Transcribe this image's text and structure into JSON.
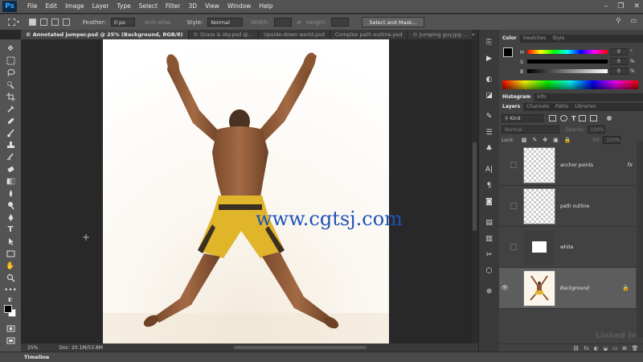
{
  "app": {
    "logo": "Ps"
  },
  "menu": [
    "File",
    "Edit",
    "Image",
    "Layer",
    "Type",
    "Select",
    "Filter",
    "3D",
    "View",
    "Window",
    "Help"
  ],
  "window_controls": [
    "–",
    "❐",
    "✕"
  ],
  "options_bar": {
    "feather_label": "Feather:",
    "feather_value": "0 px",
    "antialias_label": "Anti-alias",
    "style_label": "Style:",
    "style_value": "Normal",
    "width_label": "Width:",
    "height_label": "Height:",
    "select_mask_button": "Select and Mask..."
  },
  "tabs": [
    "© Annotated jumper.psd @ 25% (Background, RGB/8)",
    "© Grass & sky.psd @...",
    "Upside-down world.psd",
    "Complex path outline.psd",
    "© Jumping guy.jpg ..."
  ],
  "tab_overflow": "»",
  "canvas": {
    "watermark": "www.cgtsj.com"
  },
  "status": {
    "zoom": "25%",
    "doc": "Doc: 20.1M/53.8M"
  },
  "timeline": {
    "label": "Timeline"
  },
  "color_panel": {
    "tabs": [
      "Color",
      "Swatches",
      "Style"
    ],
    "rows": [
      {
        "letter": "H",
        "value": "0"
      },
      {
        "letter": "S",
        "value": "0"
      },
      {
        "letter": "B",
        "value": "0"
      }
    ],
    "pct": "%",
    "deg": "°"
  },
  "histogram_tabs": [
    "Histogram",
    "Info"
  ],
  "layers_panel": {
    "tabs": [
      "Layers",
      "Channels",
      "Paths",
      "Libraries"
    ],
    "kind_label": "Kind",
    "blend_mode": "Normal",
    "opacity_label": "Opacity:",
    "opacity_value": "100%",
    "lock_label": "Lock:",
    "fill_label": "Fill:",
    "fill_value": "100%",
    "layers": [
      {
        "name": "anchor points",
        "fx": "fx"
      },
      {
        "name": "path outline"
      },
      {
        "name": "white"
      },
      {
        "name": "Background"
      }
    ],
    "footer_icons": [
      "⛓",
      "fx",
      "◐",
      "◒",
      "▭",
      "⊞",
      "🗑"
    ]
  },
  "watermark_brand": "Linked in",
  "colors": {
    "accent": "#31a8ff",
    "watermark": "#1e52b8",
    "shorts": "#e0b52a"
  }
}
